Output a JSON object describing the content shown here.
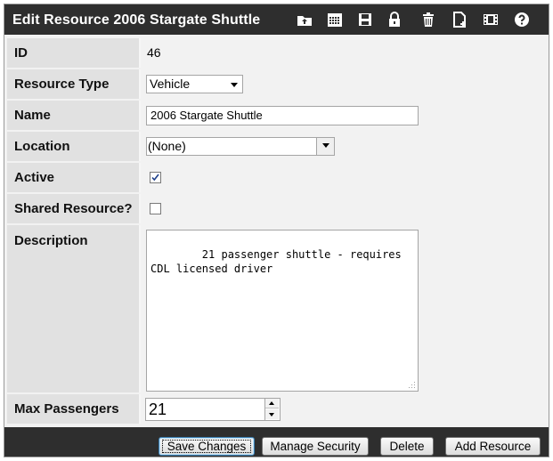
{
  "header": {
    "title": "Edit Resource 2006 Stargate Shuttle"
  },
  "toolbar": {
    "icons": [
      "upload-folder-icon",
      "calendar-icon",
      "save-icon",
      "lock-icon",
      "trash-icon",
      "new-document-icon",
      "film-icon",
      "help-icon"
    ]
  },
  "form": {
    "id": {
      "label": "ID",
      "value": "46"
    },
    "resource_type": {
      "label": "Resource Type",
      "value": "Vehicle"
    },
    "name": {
      "label": "Name",
      "value": "2006 Stargate Shuttle"
    },
    "location": {
      "label": "Location",
      "value": "(None)"
    },
    "active": {
      "label": "Active",
      "checked": true
    },
    "shared": {
      "label": "Shared Resource?",
      "checked": false
    },
    "description": {
      "label": "Description",
      "value": "21 passenger shuttle - requires CDL licensed driver"
    },
    "max_passengers": {
      "label": "Max Passengers",
      "value": "21"
    }
  },
  "footer": {
    "save_label": "Save Changes",
    "security_label": "Manage Security",
    "delete_label": "Delete",
    "add_label": "Add Resource"
  },
  "colors": {
    "bar": "#2e2e2e",
    "label_bg": "#e1e1e1",
    "panel_bg": "#f2f2f2"
  }
}
